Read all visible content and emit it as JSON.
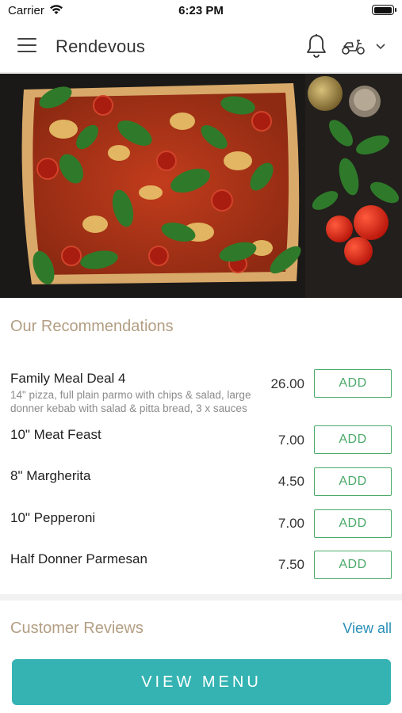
{
  "status_bar": {
    "carrier": "Carrier",
    "time": "6:23 PM",
    "battery_level": 0.9
  },
  "header": {
    "title": "Rendevous",
    "icons": {
      "menu": "hamburger-menu-icon",
      "notifications": "bell-icon",
      "delivery": "scooter-icon",
      "dropdown": "chevron-down-icon"
    }
  },
  "hero": {
    "image": "pizza-with-basil-tomatoes-photo"
  },
  "recommendations": {
    "title": "Our Recommendations",
    "items": [
      {
        "name": "Family Meal Deal 4",
        "description": "14\" pizza, full plain parmo with chips & salad, large donner kebab with salad & pitta bread, 3 x sauces",
        "price": "26.00",
        "button": "ADD"
      },
      {
        "name": "10\" Meat Feast",
        "description": "",
        "price": "7.00",
        "button": "ADD"
      },
      {
        "name": "8\" Margherita",
        "description": "",
        "price": "4.50",
        "button": "ADD"
      },
      {
        "name": "10\" Pepperoni",
        "description": "",
        "price": "7.00",
        "button": "ADD"
      },
      {
        "name": "Half Donner Parmesan",
        "description": "",
        "price": "7.50",
        "button": "ADD"
      }
    ]
  },
  "reviews": {
    "title": "Customer Reviews",
    "view_all": "View all"
  },
  "footer": {
    "button": "VIEW MENU"
  },
  "colors": {
    "section_title": "#b39e83",
    "add_button": "#4caa6a",
    "link": "#2a8fb8",
    "primary_button": "#35b3b3"
  }
}
